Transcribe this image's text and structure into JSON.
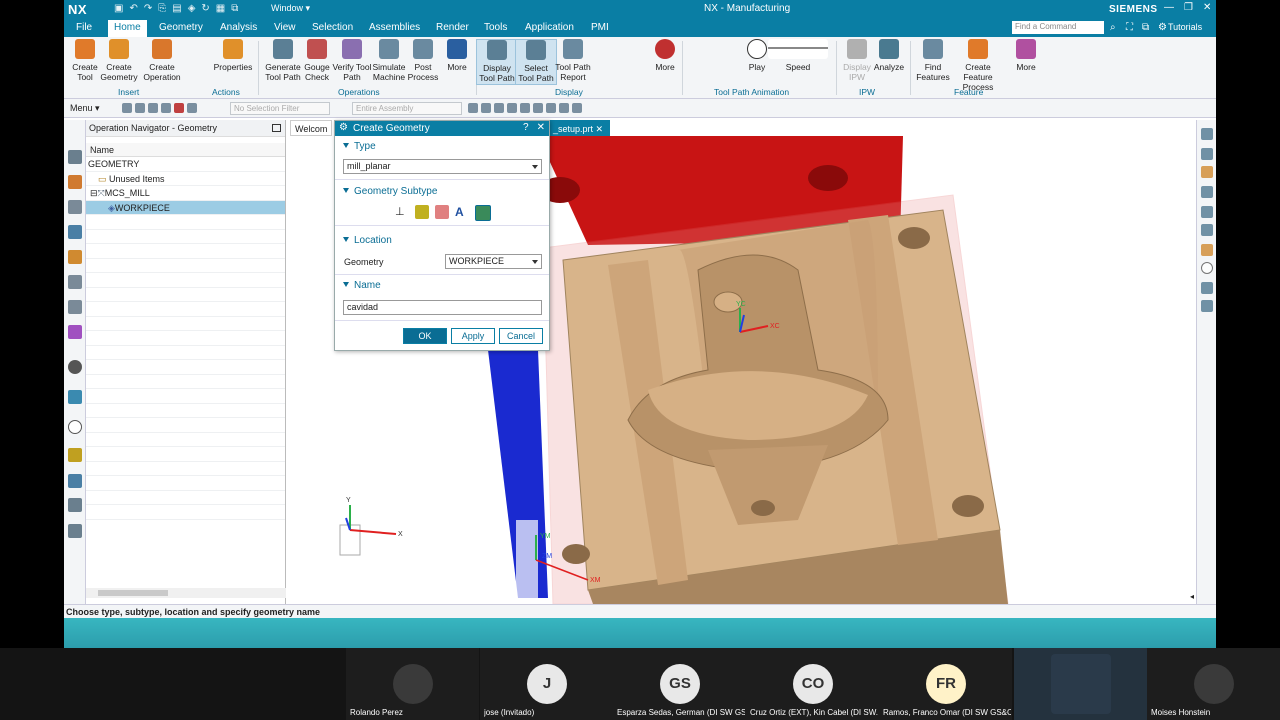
{
  "titlebar": {
    "logo": "NX",
    "window_menu": "Window ▾",
    "title": "NX - Manufacturing",
    "brand": "SIEMENS"
  },
  "menubar": {
    "tabs": [
      "File",
      "Home",
      "Geometry",
      "Analysis",
      "View",
      "Selection",
      "Assemblies",
      "Render",
      "Tools",
      "Application",
      "PMI"
    ],
    "active_tab": "Home",
    "search_placeholder": "Find a Command",
    "tutorials": "Tutorials"
  },
  "ribbon": {
    "buttons": [
      {
        "label": "Create Tool",
        "icon": "create-tool-icon",
        "color": "#e07a2a"
      },
      {
        "label": "Create Geometry",
        "icon": "create-geometry-icon",
        "color": "#e0902a"
      },
      {
        "label": "Create Operation",
        "icon": "create-operation-icon",
        "color": "#d9772c"
      },
      {
        "label": "Properties",
        "icon": "properties-icon",
        "color": "#e0902a"
      },
      {
        "label": "Generate Tool Path",
        "icon": "generate-tool-path-icon",
        "color": "#5b7f95"
      },
      {
        "label": "Gouge Check",
        "icon": "gouge-check-icon",
        "color": "#c05050"
      },
      {
        "label": "Verify Tool Path",
        "icon": "verify-tool-path-icon",
        "color": "#8a6fb0"
      },
      {
        "label": "Simulate Machine",
        "icon": "simulate-machine-icon",
        "color": "#6a8aa0"
      },
      {
        "label": "Post Process",
        "icon": "post-process-icon",
        "color": "#6a8aa0"
      },
      {
        "label": "More",
        "icon": "more-icon",
        "color": "#2a5fa0"
      },
      {
        "label": "Display Tool Path",
        "icon": "display-tool-path-icon",
        "color": "#5b7f95"
      },
      {
        "label": "Select Tool Path",
        "icon": "select-tool-path-icon",
        "color": "#5b7f95"
      },
      {
        "label": "Tool Path Report",
        "icon": "tool-path-report-icon",
        "color": "#6a8aa0"
      },
      {
        "label": "More",
        "icon": "more-icon",
        "color": "#c03030"
      },
      {
        "label": "Play",
        "icon": "play-icon",
        "color": "#ffffff"
      },
      {
        "label": "Speed",
        "icon": "speed-slider-icon",
        "color": "#0a7ea4"
      },
      {
        "label": "Display IPW",
        "icon": "display-ipw-icon",
        "color": "#b0b0b0"
      },
      {
        "label": "Analyze",
        "icon": "analyze-icon",
        "color": "#4a7a90"
      },
      {
        "label": "Find Features",
        "icon": "find-features-icon",
        "color": "#6a8aa0"
      },
      {
        "label": "Create Feature Process",
        "icon": "create-feature-process-icon",
        "color": "#e07a2a"
      },
      {
        "label": "More",
        "icon": "more-icon",
        "color": "#b050a0"
      }
    ],
    "groups": [
      "Insert",
      "Actions",
      "Operations",
      "Display",
      "Tool Path Animation",
      "IPW",
      "Feature"
    ]
  },
  "toolbar2": {
    "menu_label": "Menu ▾",
    "selection_filter": "No Selection Filter",
    "assembly_filter": "Entire Assembly"
  },
  "navigator": {
    "title": "Operation Navigator - Geometry",
    "column": "Name",
    "rows": [
      {
        "label": "GEOMETRY",
        "indent": 0,
        "selected": false
      },
      {
        "label": "Unused Items",
        "indent": 1,
        "selected": false
      },
      {
        "label": "MCS_MILL",
        "indent": 1,
        "selected": false
      },
      {
        "label": "WORKPIECE",
        "indent": 2,
        "selected": true
      }
    ]
  },
  "viewport_tabs": [
    {
      "label": "Welcom",
      "active": false
    },
    {
      "label": "_setup.prt",
      "active": true
    }
  ],
  "dialog": {
    "title": "Create Geometry",
    "help": "?",
    "close": "✕",
    "type_section": "Type",
    "type_value": "mill_planar",
    "subtype_section": "Geometry Subtype",
    "location_section": "Location",
    "geometry_label": "Geometry",
    "geometry_value": "WORKPIECE",
    "name_section": "Name",
    "name_value": "cavidad",
    "ok": "OK",
    "apply": "Apply",
    "cancel": "Cancel"
  },
  "triad": {
    "y": "Y",
    "x": "X",
    "zm": "ZM",
    "ym": "YM",
    "xm": "XM",
    "yc": "YC",
    "xc": "XC"
  },
  "status": "Choose type, subtype, location and specify geometry name",
  "participants": [
    {
      "name": "Rolando Perez",
      "initials": "",
      "color": "#3a3a3a"
    },
    {
      "name": "jose (Invitado)",
      "initials": "J",
      "color": "#e8e8e8"
    },
    {
      "name": "Esparza Sedas, German (DI SW GS&...",
      "initials": "GS",
      "color": "#e8e8e8"
    },
    {
      "name": "Cruz Ortiz (EXT), Kin Cabel (DI SW...",
      "initials": "CO",
      "color": "#e8e8e8"
    },
    {
      "name": "Ramos, Franco Omar (DI SW GS&CS...",
      "initials": "FR",
      "color": "#fff2c8"
    },
    {
      "name": "",
      "initials": "",
      "color": "#2a3a4a"
    },
    {
      "name": "Moises Honstein",
      "initials": "",
      "color": "#3a3a3a"
    }
  ]
}
